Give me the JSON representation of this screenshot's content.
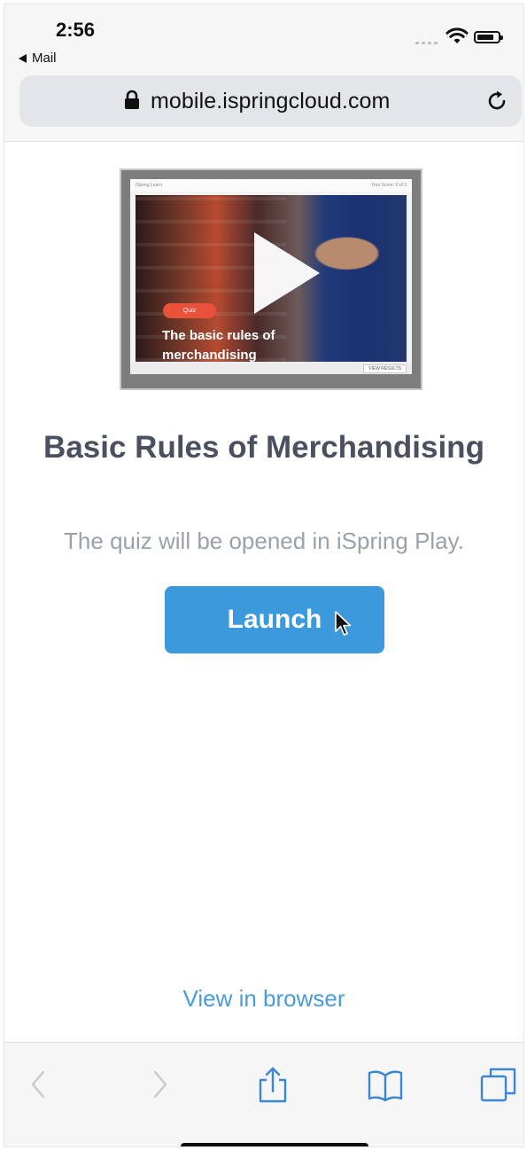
{
  "status_bar": {
    "time": "2:56",
    "back_app": "Mail"
  },
  "browser": {
    "url": "mobile.ispringcloud.com"
  },
  "thumbnail": {
    "header_left": "iSpring Learn",
    "header_right": "Your Score: 0 of 3",
    "badge": "Quiz",
    "title": "The basic rules of merchandising",
    "footer_button": "VIEW RESULTS"
  },
  "content": {
    "title": "Basic Rules of Merchandising",
    "subtitle": "The quiz will be opened in iSpring Play.",
    "launch_label": "Launch",
    "view_in_browser": "View in browser"
  },
  "toolbar": {
    "icons": [
      "back-icon",
      "forward-icon",
      "share-icon",
      "bookmarks-icon",
      "tabs-icon"
    ]
  },
  "colors": {
    "accent": "#3b99dc",
    "link": "#4a9be0",
    "title": "#4a5060",
    "subtitle": "#9aa1ab",
    "badge": "#e8523a"
  }
}
